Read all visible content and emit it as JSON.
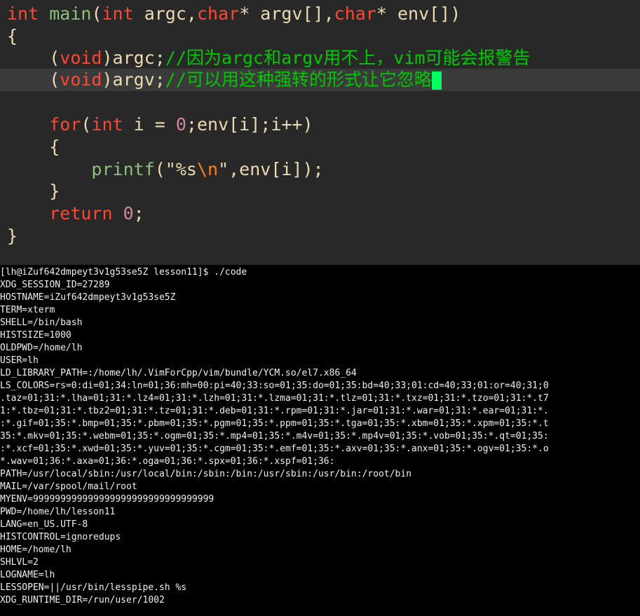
{
  "editor": {
    "lines": [
      [
        {
          "t": "type",
          "v": "int"
        },
        {
          "t": "plain",
          "v": " "
        },
        {
          "t": "func",
          "v": "main"
        },
        {
          "t": "plain",
          "v": "("
        },
        {
          "t": "type",
          "v": "int"
        },
        {
          "t": "plain",
          "v": " argc,"
        },
        {
          "t": "type",
          "v": "char"
        },
        {
          "t": "plain",
          "v": "* argv[],"
        },
        {
          "t": "type",
          "v": "char"
        },
        {
          "t": "plain",
          "v": "* env[])"
        }
      ],
      [
        {
          "t": "plain",
          "v": "{"
        }
      ],
      [
        {
          "t": "plain",
          "v": "    ("
        },
        {
          "t": "type",
          "v": "void"
        },
        {
          "t": "plain",
          "v": ")argc;"
        },
        {
          "t": "cmt",
          "v": "//因为argc和argv用不上，vim可能会报警告"
        }
      ],
      [
        {
          "t": "plain",
          "v": "    ("
        },
        {
          "t": "type",
          "v": "void"
        },
        {
          "t": "plain",
          "v": ")argv;"
        },
        {
          "t": "cmt",
          "v": "//可以用这种强转的形式让它忽略"
        }
      ],
      [],
      [
        {
          "t": "plain",
          "v": "    "
        },
        {
          "t": "kw",
          "v": "for"
        },
        {
          "t": "plain",
          "v": "("
        },
        {
          "t": "type",
          "v": "int"
        },
        {
          "t": "plain",
          "v": " i = "
        },
        {
          "t": "num",
          "v": "0"
        },
        {
          "t": "plain",
          "v": ";env[i];i++)"
        }
      ],
      [
        {
          "t": "plain",
          "v": "    {"
        }
      ],
      [
        {
          "t": "plain",
          "v": "        "
        },
        {
          "t": "func",
          "v": "printf"
        },
        {
          "t": "plain",
          "v": "("
        },
        {
          "t": "str",
          "v": "\"%s"
        },
        {
          "t": "esc",
          "v": "\\n"
        },
        {
          "t": "str",
          "v": "\""
        },
        {
          "t": "plain",
          "v": ",env[i]);"
        }
      ],
      [
        {
          "t": "plain",
          "v": "    }"
        }
      ],
      [
        {
          "t": "plain",
          "v": "    "
        },
        {
          "t": "kw",
          "v": "return"
        },
        {
          "t": "plain",
          "v": " "
        },
        {
          "t": "num",
          "v": "0"
        },
        {
          "t": "plain",
          "v": ";"
        }
      ],
      [
        {
          "t": "plain",
          "v": "}"
        }
      ]
    ]
  },
  "terminal": {
    "lines": [
      "[lh@iZuf642dmpeyt3v1g53se5Z lesson11]$ ./code",
      "XDG_SESSION_ID=27289",
      "HOSTNAME=iZuf642dmpeyt3v1g53se5Z",
      "TERM=xterm",
      "SHELL=/bin/bash",
      "HISTSIZE=1000",
      "OLDPWD=/home/lh",
      "USER=lh",
      "LD_LIBRARY_PATH=:/home/lh/.VimForCpp/vim/bundle/YCM.so/el7.x86_64",
      "LS_COLORS=rs=0:di=01;34:ln=01;36:mh=00:pi=40;33:so=01;35:do=01;35:bd=40;33;01:cd=40;33;01:or=40;31;0",
      ".taz=01;31:*.lha=01;31:*.lz4=01;31:*.lzh=01;31:*.lzma=01;31:*.tlz=01;31:*.txz=01;31:*.tzo=01;31:*.t7",
      "1:*.tbz=01;31:*.tbz2=01;31:*.tz=01;31:*.deb=01;31:*.rpm=01;31:*.jar=01;31:*.war=01;31:*.ear=01;31:*.",
      ":*.gif=01;35:*.bmp=01;35:*.pbm=01;35:*.pgm=01;35:*.ppm=01;35:*.tga=01;35:*.xbm=01;35:*.xpm=01;35:*.t",
      "35:*.mkv=01;35:*.webm=01;35:*.ogm=01;35:*.mp4=01;35:*.m4v=01;35:*.mp4v=01;35:*.vob=01;35:*.qt=01;35:",
      ":*.xcf=01;35:*.xwd=01;35:*.yuv=01;35:*.cgm=01;35:*.emf=01;35:*.axv=01;35:*.anx=01;35:*.ogv=01;35:*.o",
      "*.wav=01;36:*.axa=01;36:*.oga=01;36:*.spx=01;36:*.xspf=01;36:",
      "PATH=/usr/local/sbin:/usr/local/bin:/sbin:/bin:/usr/sbin:/usr/bin:/root/bin",
      "MAIL=/var/spool/mail/root",
      "MYENV=999999999999999999999999999999999",
      "PWD=/home/lh/lesson11",
      "LANG=en_US.UTF-8",
      "HISTCONTROL=ignoredups",
      "HOME=/home/lh",
      "SHLVL=2",
      "LOGNAME=lh",
      "LESSOPEN=||/usr/bin/lesspipe.sh %s",
      "XDG_RUNTIME_DIR=/run/user/1002"
    ]
  }
}
